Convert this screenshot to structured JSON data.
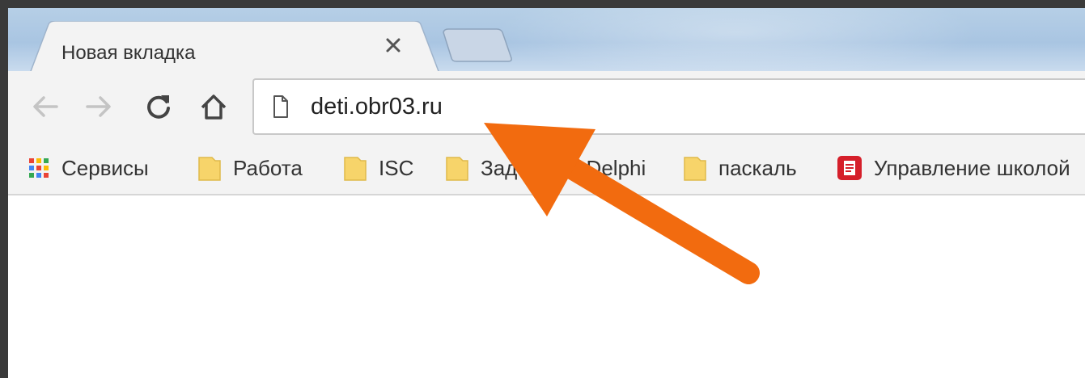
{
  "tab": {
    "title": "Новая вкладка"
  },
  "omnibox": {
    "url": "deti.obr03.ru"
  },
  "bookmarks": [
    {
      "label": "Сервисы",
      "icon": "apps-grid-icon"
    },
    {
      "label": "Работа",
      "icon": "folder-icon"
    },
    {
      "label": "ISC",
      "icon": "folder-icon"
    },
    {
      "label": "Задачи на Delphi",
      "icon": "folder-icon"
    },
    {
      "label": "паскаль",
      "icon": "folder-icon"
    },
    {
      "label": "Управление школой",
      "icon": "document-icon"
    }
  ],
  "colors": {
    "annotation_arrow": "#f26b0f",
    "folder": "#f7d46a",
    "document_icon": "#d51f2a"
  }
}
